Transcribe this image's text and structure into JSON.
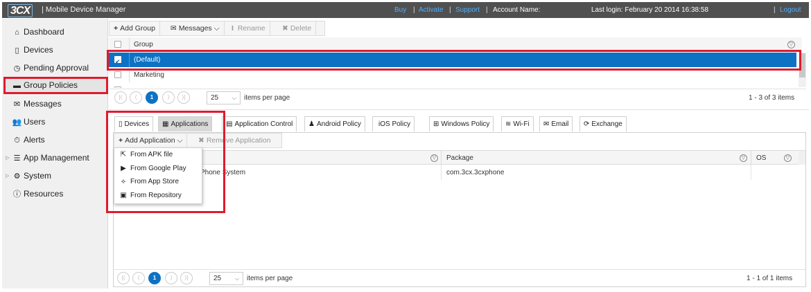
{
  "header": {
    "logo": "3CX",
    "title": "| Mobile Device Manager",
    "links": {
      "buy": "Buy",
      "activate": "Activate",
      "support": "Support",
      "logout": "Logout"
    },
    "account_label": "Account Name:",
    "last_login": "Last login: February 20 2014 16:38:58",
    "sep": "|"
  },
  "sidebar": {
    "items": [
      {
        "label": "Dashboard",
        "icon": "home-icon"
      },
      {
        "label": "Devices",
        "icon": "phone-icon"
      },
      {
        "label": "Pending Approval",
        "icon": "clock-icon"
      },
      {
        "label": "Group Policies",
        "icon": "folder-icon",
        "active": true
      },
      {
        "label": "Messages",
        "icon": "envelope-icon"
      },
      {
        "label": "Users",
        "icon": "users-icon"
      },
      {
        "label": "Alerts",
        "icon": "stopwatch-icon"
      },
      {
        "label": "App Management",
        "icon": "server-icon",
        "expandable": true
      },
      {
        "label": "System",
        "icon": "gears-icon",
        "expandable": true
      },
      {
        "label": "Resources",
        "icon": "info-icon"
      }
    ]
  },
  "groups_toolbar": {
    "add_group": "Add Group",
    "messages": "Messages",
    "rename": "Rename",
    "delete": "Delete"
  },
  "groups_grid": {
    "column": "Group",
    "rows": [
      {
        "name": "(Default)",
        "selected": true,
        "checked": true
      },
      {
        "name": "Marketing",
        "selected": false,
        "checked": false
      }
    ]
  },
  "groups_pager": {
    "current_page": "1",
    "page_size": "25",
    "items_per_page": "items per page",
    "summary": "1 - 3 of 3 items"
  },
  "policy_tabs": [
    {
      "label": "Devices",
      "icon": "phone-icon"
    },
    {
      "label": "Applications",
      "icon": "monitor-icon",
      "active": true
    },
    {
      "label": "Application Control",
      "icon": "grid-icon"
    },
    {
      "label": "Android Policy",
      "icon": "android-icon"
    },
    {
      "label": "iOS Policy",
      "icon": "apple-icon"
    },
    {
      "label": "Windows Policy",
      "icon": "windows-icon"
    },
    {
      "label": "Wi-Fi",
      "icon": "wifi-icon"
    },
    {
      "label": "Email",
      "icon": "envelope-icon"
    },
    {
      "label": "Exchange",
      "icon": "sync-icon"
    }
  ],
  "apps_toolbar": {
    "add_application": "Add Application",
    "remove_application": "Remove Application"
  },
  "add_app_menu": [
    {
      "label": "From APK file",
      "icon": "apk-file-icon"
    },
    {
      "label": "From Google Play",
      "icon": "play-icon"
    },
    {
      "label": "From App Store",
      "icon": "app-store-icon"
    },
    {
      "label": "From Repository",
      "icon": "repository-icon"
    }
  ],
  "apps_grid": {
    "columns": {
      "package": "Package",
      "os": "OS"
    },
    "rows": [
      {
        "name": "Phone System",
        "package": "com.3cx.3cxphone",
        "os": "apple-icon"
      }
    ]
  },
  "apps_pager": {
    "current_page": "1",
    "page_size": "25",
    "items_per_page": "items per page",
    "summary": "1 - 1 of 1 items"
  },
  "colors": {
    "header_bg": "#505050",
    "accent_blue": "#0d72c4",
    "highlight_red": "#e01a2e",
    "link_blue": "#4fb0ff"
  }
}
